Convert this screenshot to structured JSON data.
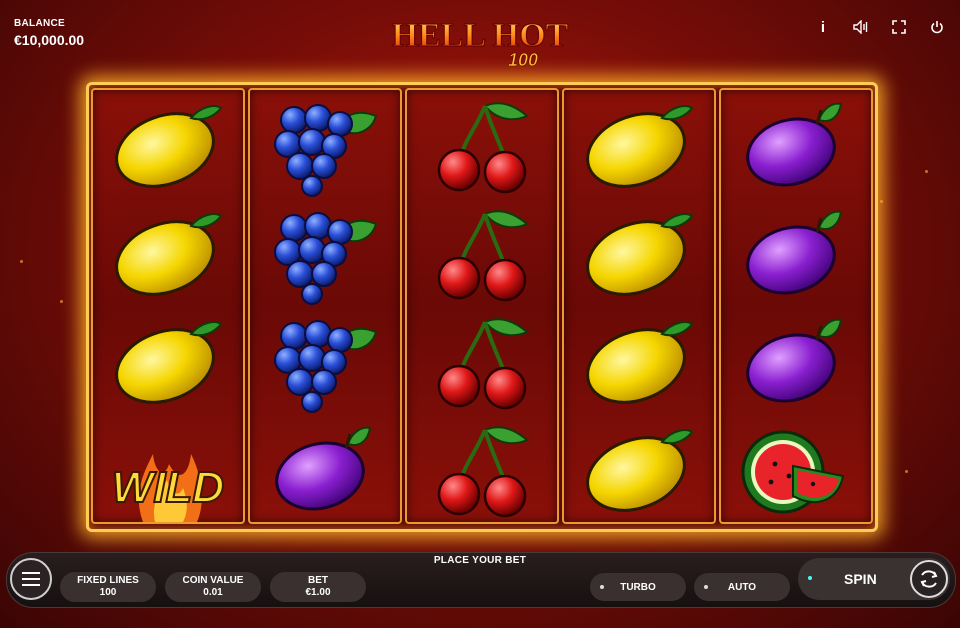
{
  "balance": {
    "label": "BALANCE",
    "value": "€10,000.00"
  },
  "logo": {
    "line1": "HELL HOT",
    "line2": "100"
  },
  "top_icons": [
    {
      "name": "info-icon",
      "glyph": "i"
    },
    {
      "name": "sound-icon",
      "glyph": "sound"
    },
    {
      "name": "fullscreen-icon",
      "glyph": "fullscreen"
    },
    {
      "name": "power-icon",
      "glyph": "power"
    }
  ],
  "reels": [
    [
      "lemon",
      "lemon",
      "lemon",
      "wild"
    ],
    [
      "grapes",
      "grapes",
      "grapes",
      "plum"
    ],
    [
      "cherry",
      "cherry",
      "cherry",
      "cherry"
    ],
    [
      "lemon",
      "lemon",
      "lemon",
      "lemon"
    ],
    [
      "plum",
      "plum",
      "plum",
      "watermelon"
    ]
  ],
  "wild_text": "WILD",
  "bottom": {
    "place_bet": "PLACE YOUR BET",
    "fixed_lines": {
      "label": "FIXED LINES",
      "value": "100"
    },
    "coin_value": {
      "label": "COIN VALUE",
      "value": "0.01"
    },
    "bet": {
      "label": "BET",
      "value": "€1.00"
    },
    "turbo": "TURBO",
    "auto": "AUTO",
    "spin": "SPIN"
  },
  "colors": {
    "accent": "#ffcc55",
    "background": "#7a0d08",
    "bar": "#1e1616"
  }
}
